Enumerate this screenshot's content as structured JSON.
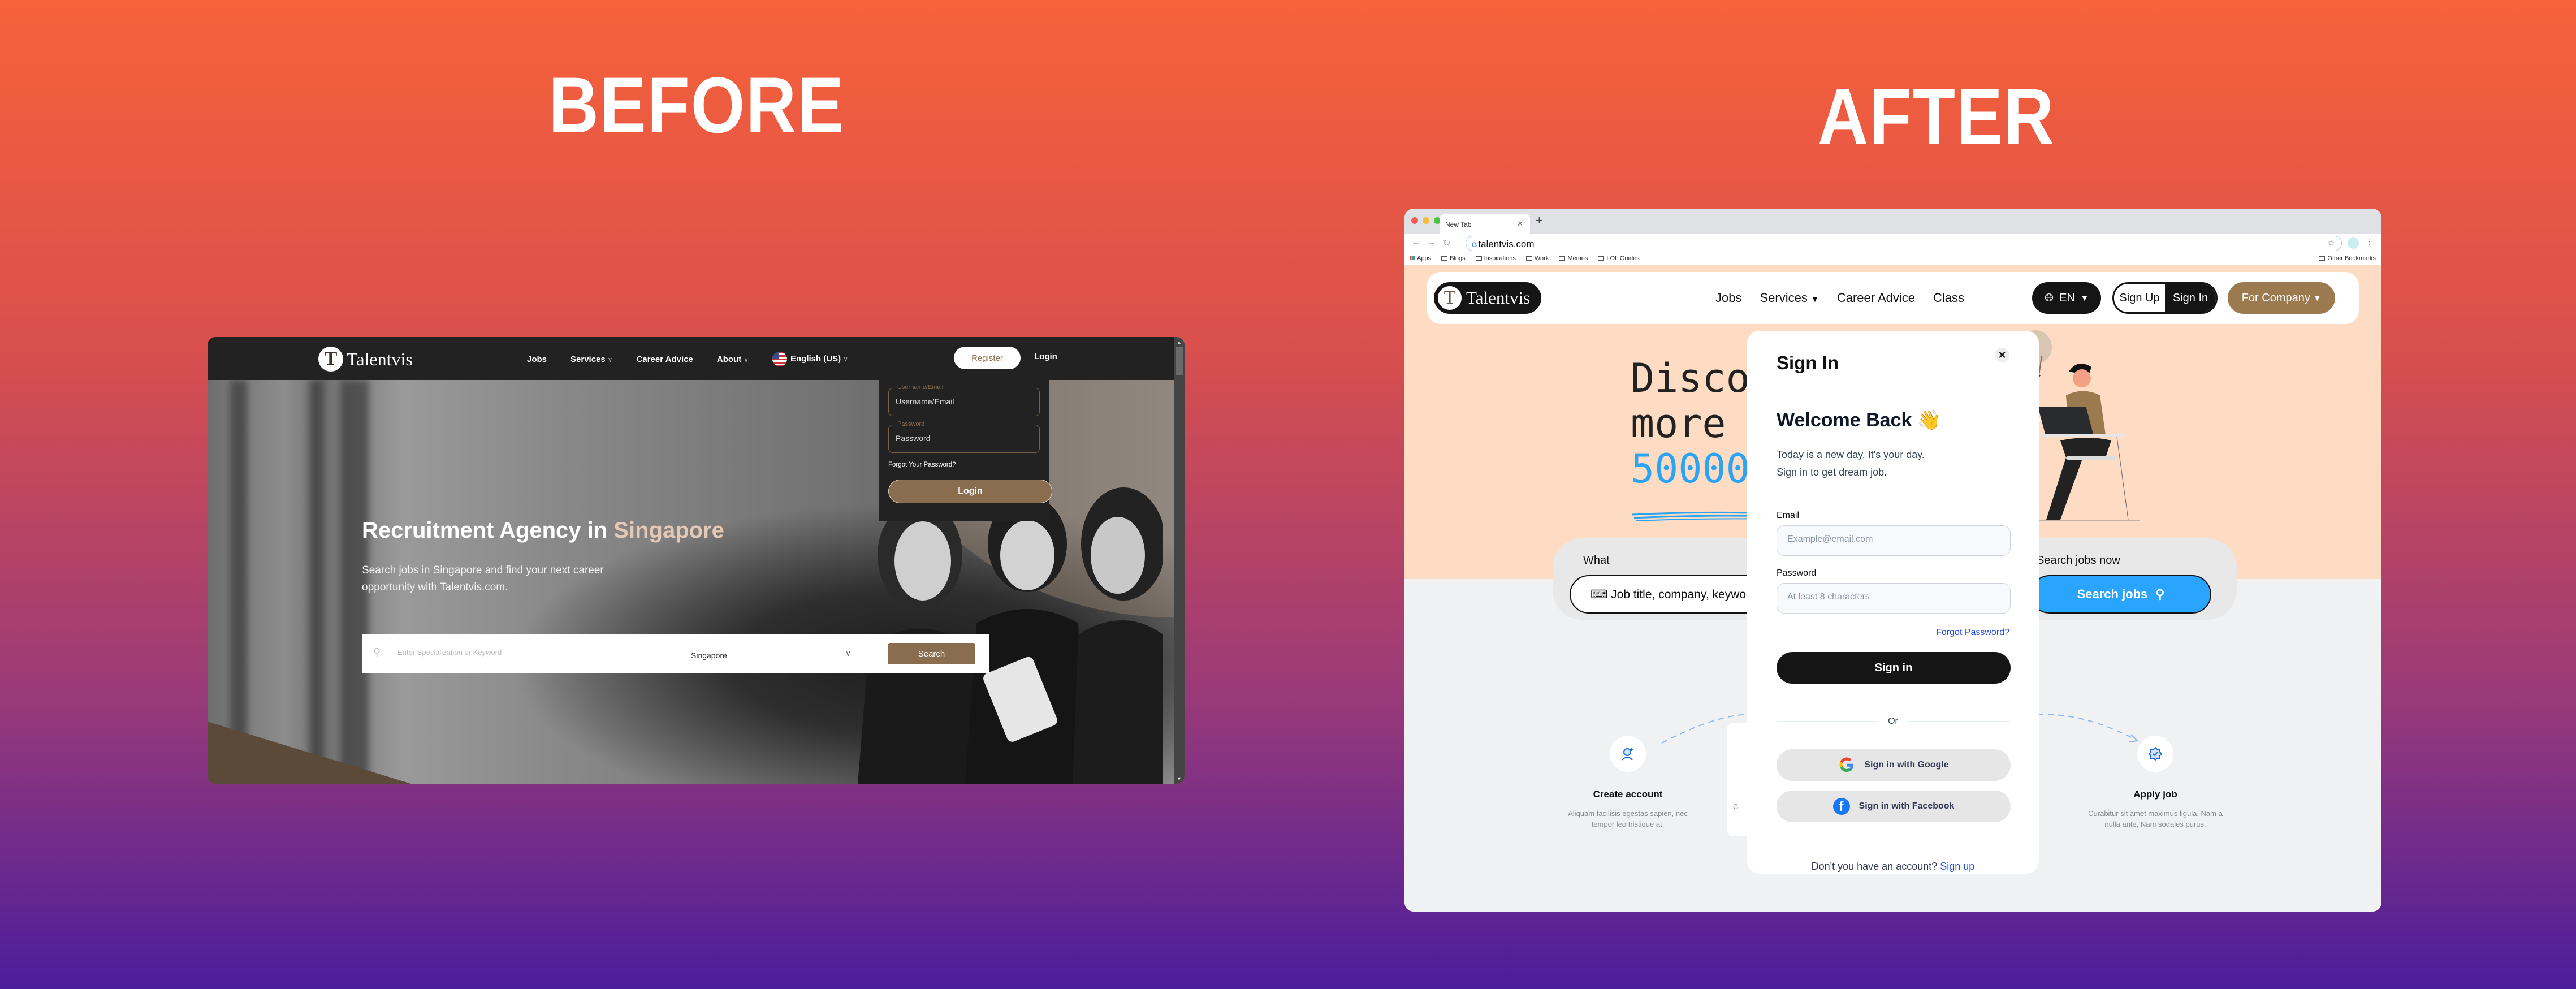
{
  "labels": {
    "before": "BEFORE",
    "after": "AFTER"
  },
  "before": {
    "logo": {
      "mark": "T",
      "name": "Talentvis"
    },
    "nav": {
      "items": [
        {
          "label": "Jobs",
          "dropdown": false
        },
        {
          "label": "Services",
          "dropdown": true
        },
        {
          "label": "Career Advice",
          "dropdown": false
        },
        {
          "label": "About",
          "dropdown": true
        }
      ],
      "language": "English (US)",
      "register": "Register",
      "login": "Login"
    },
    "login_dropdown": {
      "username_legend": "Username/Email",
      "username_placeholder": "Username/Email",
      "password_legend": "Password",
      "password_placeholder": "Password",
      "forgot": "Forgot Your Password?",
      "login_button": "Login"
    },
    "hero": {
      "title_prefix": "Recruitment Agency in ",
      "title_accent": "Singapore",
      "subtitle": "Search jobs in Singapore and find your next career opportunity with Talentvis.com."
    },
    "search": {
      "placeholder": "Enter Specialization or Keyword",
      "location": "Singapore",
      "button": "Search"
    },
    "colors": {
      "brand_brown": "#8a6d4f",
      "nav_bg": "#222222",
      "accent_text": "#e4c8b3"
    }
  },
  "after": {
    "browser": {
      "tab_title": "New Tab",
      "url": "talentvis.com",
      "bookmarks": [
        "Apps",
        "Blogs",
        "Inspirations",
        "Work",
        "Memes",
        "LOL Guides"
      ],
      "other_bookmarks": "Other Bookmarks"
    },
    "nav": {
      "logo": {
        "mark": "T",
        "name": "Talentvis"
      },
      "items": [
        {
          "label": "Jobs"
        },
        {
          "label": "Services",
          "caret": "▼"
        },
        {
          "label": "Career Advice"
        },
        {
          "label": "Class"
        }
      ],
      "language": "EN",
      "sign_up": "Sign Up",
      "sign_in": "Sign In",
      "for_company": "For Company"
    },
    "hero": {
      "line1": "Disco",
      "line2": "more",
      "line3": "50000"
    },
    "search": {
      "what_label": "What",
      "what_placeholder": "Job title, company, keywords",
      "cta_label": "Search jobs now",
      "button": "Search jobs"
    },
    "steps": [
      {
        "title": "Create account",
        "desc": "Aliquam facilisis egestas sapien, nec tempor leo tristique at.",
        "icon": "user-plus-icon"
      },
      {
        "title": "Apply job",
        "desc": "Curabitur sit amet maximus ligula. Nam a nulla ante, Nam sodales purus.",
        "icon": "badge-check-icon"
      }
    ],
    "modal": {
      "title": "Sign In",
      "welcome": "Welcome Back 👋",
      "intro_line1": "Today is a new day. It's your day.",
      "intro_line2": "Sign in to get dream job.",
      "email_label": "Email",
      "email_placeholder": "Example@email.com",
      "password_label": "Password",
      "password_placeholder": "At least 8 characters",
      "forgot": "Forgot Password?",
      "signin_button": "Sign in",
      "divider": "Or",
      "google_button": "Sign in with Google",
      "facebook_button": "Sign in with Facebook",
      "no_account": "Don't you have an account?",
      "sign_up_link": "Sign up"
    },
    "colors": {
      "primary_blue": "#29a4ff",
      "link_blue": "#1e4ae9",
      "peach": "#fddcc3",
      "company_brown": "#9a7a4e",
      "dark": "#151515"
    }
  }
}
